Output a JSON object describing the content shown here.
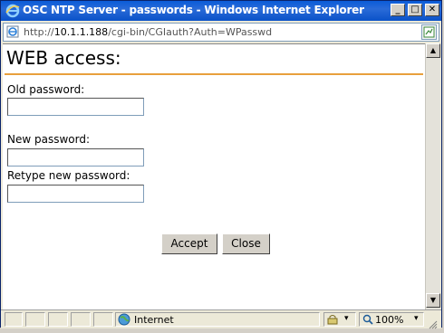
{
  "window": {
    "title": "OSC NTP Server - passwords - Windows Internet Explorer",
    "minimize_glyph": "_",
    "maximize_glyph": "□",
    "close_glyph": "✕"
  },
  "address": {
    "scheme": "http://",
    "host": "10.1.1.188",
    "path": "/cgi-bin/CGIauth?Auth=WPasswd"
  },
  "page": {
    "heading": "WEB access:",
    "accent_color": "#e8a03c",
    "fields": [
      {
        "label": "Old password:",
        "value": ""
      },
      {
        "label": "New password:",
        "value": ""
      },
      {
        "label": "Retype new password:",
        "value": ""
      }
    ],
    "accept_label": "Accept",
    "close_label": "Close"
  },
  "status": {
    "zone": "Internet",
    "zoom": "100%",
    "zoom_caret": "▾",
    "protected_caret": "▾"
  },
  "scroll": {
    "up_glyph": "▲",
    "down_glyph": "▼"
  }
}
